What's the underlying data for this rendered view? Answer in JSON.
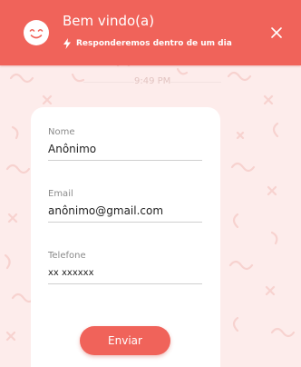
{
  "header": {
    "title": "Bem vindo(a)",
    "subtitle": "Responderemos dentro de um dia",
    "avatar_icon": "smiley-face-icon",
    "subtitle_icon": "lightning-bolt-icon",
    "close_icon": "close-icon"
  },
  "chat": {
    "timestamp": "9:49 PM"
  },
  "form": {
    "fields": [
      {
        "label": "Nome",
        "value": "Anônimo"
      },
      {
        "label": "Email",
        "value": "anônimo@gmail.com"
      },
      {
        "label": "Telefone",
        "value": "xx xxxxxx"
      }
    ],
    "submit_label": "Enviar"
  },
  "colors": {
    "accent": "#f0635a",
    "background": "#fdeceb",
    "card": "#ffffff"
  }
}
